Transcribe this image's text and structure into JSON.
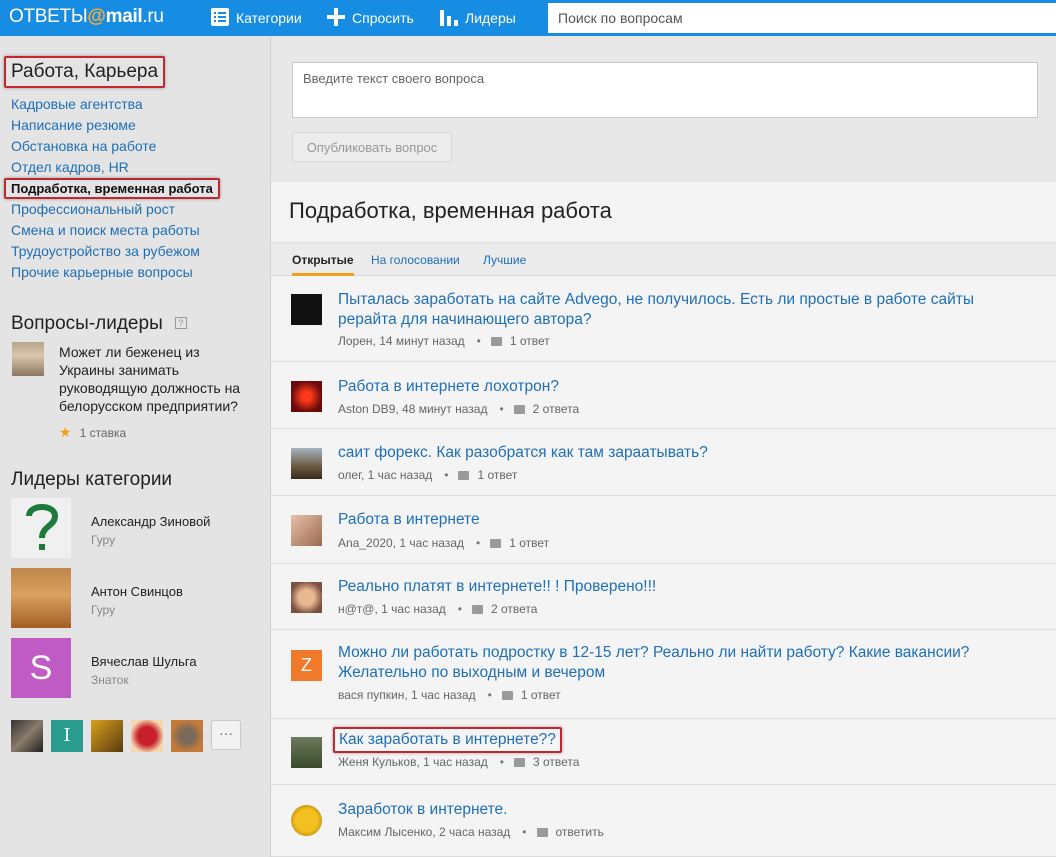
{
  "header": {
    "logo_left": "ОТВЕТЫ",
    "logo_at": "@",
    "logo_mail": "mail",
    "logo_ru": ".ru",
    "nav": [
      {
        "label": "Категории",
        "icon": "list-icon"
      },
      {
        "label": "Спросить",
        "icon": "plus-icon"
      },
      {
        "label": "Лидеры",
        "icon": "bar-chart-icon"
      }
    ],
    "search_placeholder": "Поиск по вопросам"
  },
  "sidebar": {
    "category_title": "Работа, Карьера",
    "subcategories": [
      {
        "label": "Кадровые агентства"
      },
      {
        "label": "Написание резюме"
      },
      {
        "label": "Обстановка на работе"
      },
      {
        "label": "Отдел кадров, HR"
      },
      {
        "label": "Подработка, временная работа",
        "active": true
      },
      {
        "label": "Профессиональный рост"
      },
      {
        "label": "Смена и поиск места работы"
      },
      {
        "label": "Трудоустройство за рубежом"
      },
      {
        "label": "Прочие карьерные вопросы"
      }
    ],
    "leader_questions_title": "Вопросы-лидеры",
    "help_glyph": "?",
    "leader_question": {
      "text": "Может ли беженец из Украины занимать руководящую должность на белорусском предприятии?",
      "meta": "1 ставка"
    },
    "category_leaders_title": "Лидеры категории",
    "leaders": [
      {
        "name": "Александр Зиновой",
        "rank": "Гуру"
      },
      {
        "name": "Антон Свинцов",
        "rank": "Гуру"
      },
      {
        "name": "Вячеслав Шульга",
        "rank": "Знаток",
        "initial": "S"
      }
    ],
    "mini_avatar_letter": "I",
    "more_label": "···"
  },
  "main": {
    "ask_placeholder": "Введите текст своего вопроса",
    "publish_label": "Опубликовать вопрос",
    "page_title": "Подработка, временная работа",
    "tabs": [
      {
        "label": "Открытые",
        "active": true
      },
      {
        "label": "На голосовании"
      },
      {
        "label": "Лучшие"
      }
    ],
    "questions": [
      {
        "title": "Пыталась заработать на сайте Advego, не получилось. Есть ли простые в работе сайты рерайта для начинающего автора?",
        "author": "Лорен, 14 минут назад",
        "answers": "1 ответ"
      },
      {
        "title": "Работа в интернете лохотрон?",
        "author": "Aston DB9, 48 минут назад",
        "answers": "2 ответа"
      },
      {
        "title": "саит форекс. Как разобратся как там зараатывать?",
        "author": "олег, 1 час назад",
        "answers": "1 ответ"
      },
      {
        "title": "Работа в интернете",
        "author": "Ana_2020, 1 час назад",
        "answers": "1 ответ"
      },
      {
        "title": "Реально платят в интернете!! ! Проверено!!!",
        "author": "н@т@, 1 час назад",
        "answers": "2 ответа"
      },
      {
        "title": "Можно ли работать подростку в 12-15 лет? Реально ли найти работу? Какие вакансии? Желательно по выходным и вечером",
        "author": "вася пупкин, 1 час назад",
        "answers": "1 ответ",
        "avatar_letter": "Z"
      },
      {
        "title": "Как заработать в интернете??",
        "author": "Женя Кульков, 1 час назад",
        "answers": "3 ответа"
      },
      {
        "title": "Заработок в интернете.",
        "author": "Максим Лысенко, 2 часа назад",
        "answers": "ответить"
      }
    ]
  },
  "colors": {
    "topbar": "#168de2",
    "link": "#1f6fb5",
    "highlight_border": "#c0282d",
    "tab_accent": "#f0a01b"
  }
}
